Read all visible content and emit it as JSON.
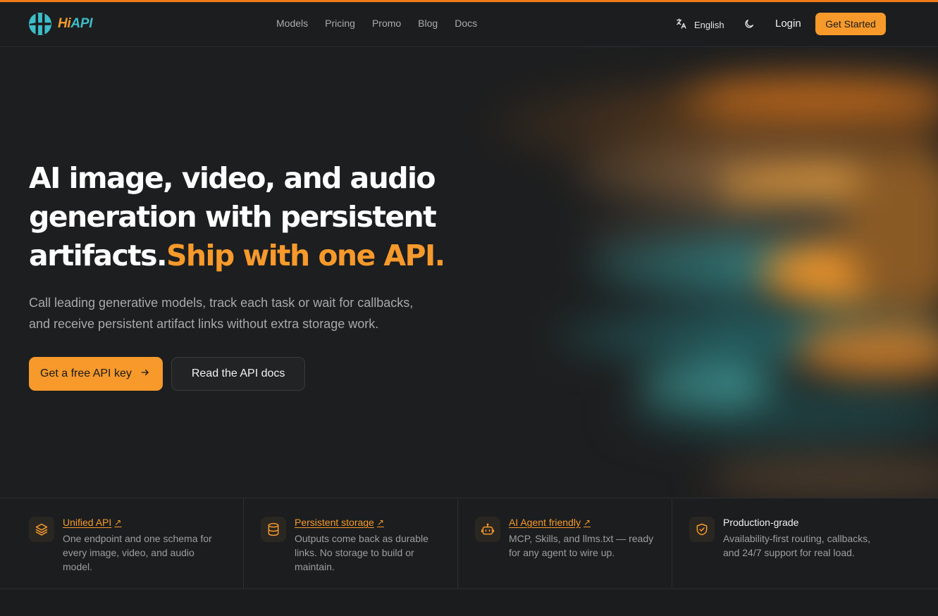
{
  "brand": {
    "hi": "Hi",
    "api": "API",
    "accent": "#f79a2b",
    "teal": "#3dbcc9"
  },
  "nav": {
    "items": [
      "Models",
      "Pricing",
      "Promo",
      "Blog",
      "Docs"
    ]
  },
  "header": {
    "language": "English",
    "language_icon": "translate-icon",
    "theme_icon": "moon-icon",
    "login": "Login",
    "get_started": "Get Started"
  },
  "hero": {
    "title_main": "AI image, video, and audio generation with persistent artifacts.",
    "title_accent": "Ship with one API.",
    "subtitle": "Call leading generative models, track each task or wait for callbacks, and receive persistent artifact links without extra storage work.",
    "cta_primary": "Get a free API key",
    "cta_primary_icon": "arrow-right-icon",
    "cta_secondary": "Read the API docs"
  },
  "features": [
    {
      "icon": "layers-icon",
      "title": "Unified API",
      "link": true,
      "desc": "One endpoint and one schema for every image, video, and audio model."
    },
    {
      "icon": "database-icon",
      "title": "Persistent storage",
      "link": true,
      "desc": "Outputs come back as durable links. No storage to build or maintain."
    },
    {
      "icon": "bot-icon",
      "title": "AI Agent friendly",
      "link": true,
      "desc": "MCP, Skills, and llms.txt — ready for any agent to wire up."
    },
    {
      "icon": "shield-check-icon",
      "title": "Production-grade",
      "link": false,
      "desc": "Availability-first routing, callbacks, and 24/7 support for real load."
    }
  ]
}
